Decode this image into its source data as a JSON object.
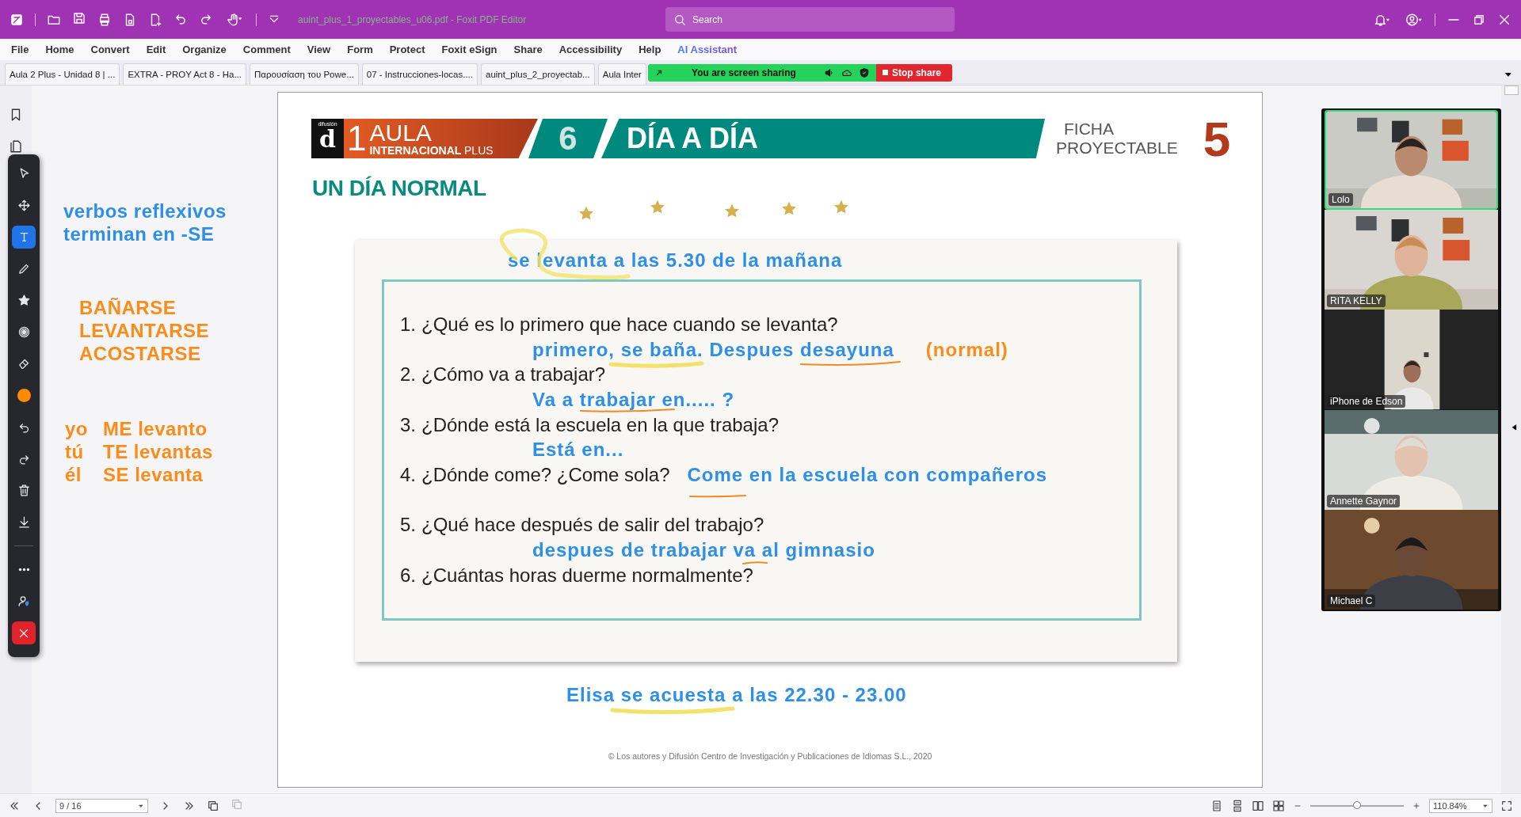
{
  "title_bar": {
    "file_title": "auint_plus_1_proyectables_u06.pdf - Foxit PDF Editor",
    "search_placeholder": "Search"
  },
  "menu": [
    {
      "label": "File",
      "kind": "plain"
    },
    {
      "label": "Home",
      "kind": "plain"
    },
    {
      "label": "Convert",
      "kind": "plain"
    },
    {
      "label": "Edit",
      "kind": "plain"
    },
    {
      "label": "Organize",
      "kind": "plain"
    },
    {
      "label": "Comment",
      "kind": "plain"
    },
    {
      "label": "View",
      "kind": "plain"
    },
    {
      "label": "Form",
      "kind": "plain"
    },
    {
      "label": "Protect",
      "kind": "plain"
    },
    {
      "label": "Foxit eSign",
      "kind": "plain"
    },
    {
      "label": "Share",
      "kind": "plain"
    },
    {
      "label": "Accessibility",
      "kind": "plain"
    },
    {
      "label": "Help",
      "kind": "plain"
    },
    {
      "label": "AI Assistant",
      "kind": "ai"
    }
  ],
  "tabs": [
    "Aula 2 Plus - Unidad 8 | ...",
    "EXTRA - PROY Act 8 - Ha...",
    "Παρουσίαση του Powe...",
    "07 - Instrucciones-locas....",
    "auint_plus_2_proyectab...",
    "Aula Inter"
  ],
  "share_banner": {
    "message": "You are screen sharing",
    "stop_label": "Stop share"
  },
  "left_toolbar": {
    "tools": [
      {
        "kind": "select",
        "selected": false
      },
      {
        "kind": "move",
        "selected": false
      },
      {
        "kind": "text",
        "selected": true
      },
      {
        "kind": "pencil",
        "selected": false
      },
      {
        "kind": "star",
        "selected": false
      },
      {
        "kind": "spotlight",
        "selected": false
      },
      {
        "kind": "eraser",
        "selected": false
      },
      {
        "kind": "color",
        "selected": false,
        "color": "#ff8c00"
      },
      {
        "kind": "undo",
        "selected": false
      },
      {
        "kind": "redo",
        "selected": false
      },
      {
        "kind": "trash",
        "selected": false
      },
      {
        "kind": "save",
        "selected": false
      },
      {
        "kind": "more",
        "selected": false
      },
      {
        "kind": "user",
        "selected": false
      },
      {
        "kind": "close",
        "selected": false
      }
    ]
  },
  "notes": {
    "rule": [
      "verbos reflexivos",
      "terminan en -SE"
    ],
    "verbs": [
      "BAÑARSE",
      "LEVANTARSE",
      "ACOSTARSE"
    ],
    "conjugation": [
      {
        "pronoun": "yo",
        "form": "ME levanto"
      },
      {
        "pronoun": "tú",
        "form": "TE levantas"
      },
      {
        "pronoun": "él",
        "form": "SE levanta"
      }
    ]
  },
  "page": {
    "header": {
      "publisher": "difusión",
      "logo_letter": "d",
      "level": "1",
      "brand": "AULA",
      "series": "INTERNACIONAL",
      "plus": "PLUS",
      "unit": "6",
      "unit_title": "DÍA A DÍA",
      "sheet_type": "FICHA",
      "sheet_subtype": "PROYECTABLE",
      "sheet_number": "5"
    },
    "section_title": "UN DÍA NORMAL",
    "worksheet": {
      "top_answer": "se levanta a las 5.30 de la mañana",
      "items": [
        {
          "kind": "question",
          "number": "1.",
          "text": "¿Qué es lo primero que hace cuando se levanta?"
        },
        {
          "kind": "answer",
          "text": "primero, se baña. Despues desayuna",
          "note": "(normal)"
        },
        {
          "kind": "question",
          "number": "2.",
          "text": "¿Cómo va a trabajar?"
        },
        {
          "kind": "answer",
          "text": "Va a trabajar en..... ?"
        },
        {
          "kind": "question",
          "number": "3.",
          "text": "¿Dónde está la escuela en la que trabaja?"
        },
        {
          "kind": "answer",
          "text": "Está en..."
        },
        {
          "kind": "question",
          "number": "4.",
          "text": "¿Dónde come? ¿Come sola?",
          "answer": "Come en la escuela con compañeros"
        },
        {
          "kind": "question",
          "number": "5.",
          "text": "¿Qué hace después de salir del trabajo?"
        },
        {
          "kind": "answer",
          "text": "despues de trabajar va al gimnasio"
        },
        {
          "kind": "question",
          "number": "6.",
          "text": "¿Cuántas horas duerme normalmente?"
        }
      ]
    },
    "bottom_answer": "Elisa se acuesta a las 22.30 - 23.00",
    "copyright": "© Los autores y Difusión Centro de Investigación y Publicaciones de Idiomas S.L., 2020"
  },
  "participants": [
    {
      "name": "Lolo",
      "speaking": true
    },
    {
      "name": "RITA KELLY",
      "speaking": false
    },
    {
      "name": "iPhone de Edson",
      "speaking": false
    },
    {
      "name": "Annette Gaynor",
      "speaking": false
    },
    {
      "name": "Michael C",
      "speaking": false
    }
  ],
  "status_bar": {
    "page_field": "9 / 16",
    "zoom_slider": {
      "level": 0.5
    },
    "zoom_field": "110.84%"
  }
}
